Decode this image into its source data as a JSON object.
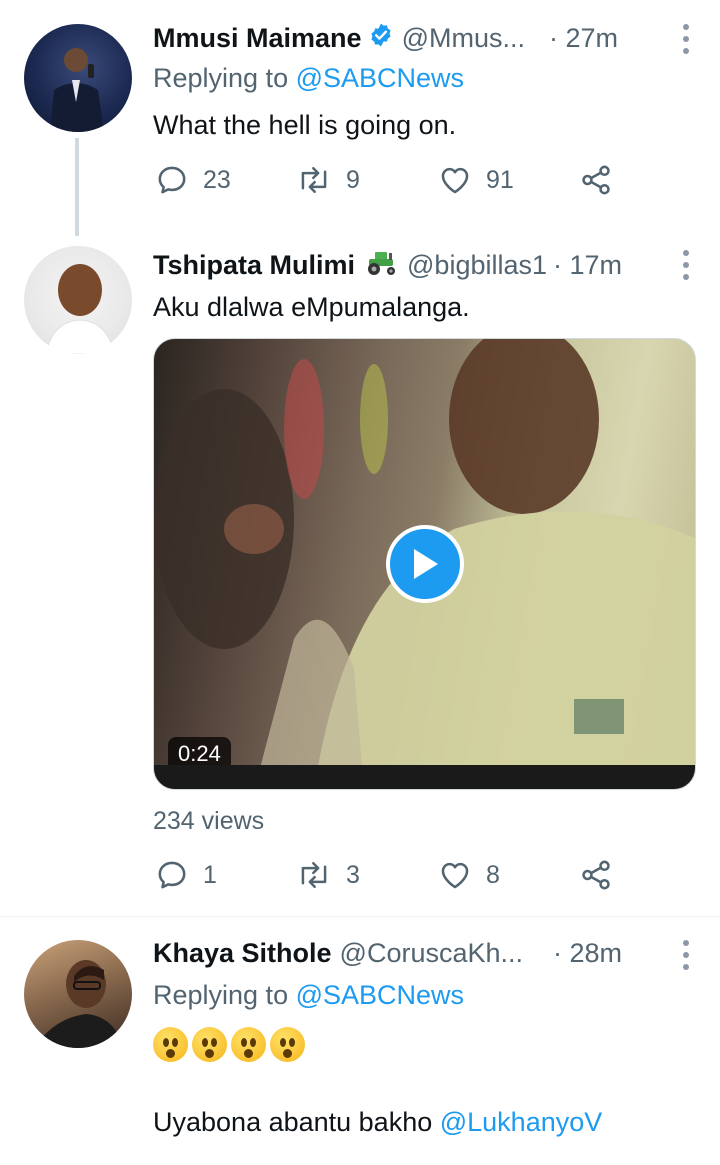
{
  "tweets": [
    {
      "name": "Mmusi Maimane",
      "handle": "@Mmus...",
      "time": "· 27m",
      "replying_prefix": "Replying to ",
      "replying_to": "@SABCNews",
      "text": "What the hell is going on.",
      "replies": "23",
      "retweets": "9",
      "likes": "91",
      "verified": true
    },
    {
      "name": "Tshipata Mulimi",
      "name_emoji": "tractor-emoji",
      "handle": "@bigbillas1",
      "time": "· 17m",
      "text": "Aku dlalwa eMpumalanga.",
      "video_duration": "0:24",
      "views": "234 views",
      "replies": "1",
      "retweets": "3",
      "likes": "8"
    },
    {
      "name": "Khaya Sithole",
      "handle": "@CoruscaKh...",
      "time": "· 28m",
      "replying_prefix": "Replying to ",
      "replying_to": "@SABCNews",
      "emojis": [
        "astonished-face-emoji",
        "astonished-face-emoji",
        "astonished-face-emoji",
        "astonished-face-emoji"
      ],
      "text_prefix": "Uyabona abantu bakho ",
      "text_mention": "@LukhanyoV"
    }
  ],
  "colors": {
    "accent": "#1d9bf0",
    "secondary_text": "#536471",
    "primary_text": "#0f1419",
    "thread_line": "#cfd9de"
  }
}
